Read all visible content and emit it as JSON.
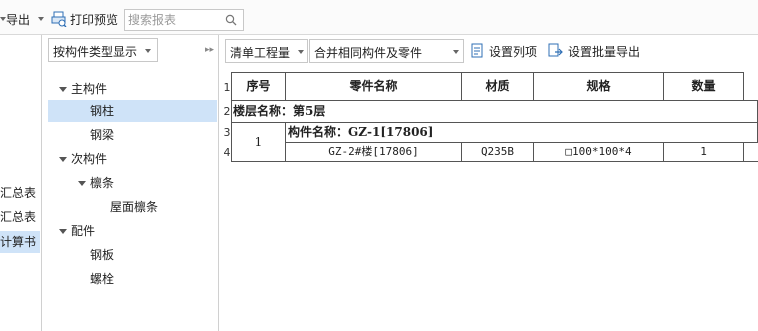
{
  "toolbar": {
    "export_label": "导出",
    "print_preview_label": "打印预览",
    "search_placeholder": "搜索报表"
  },
  "left_panel": {
    "items": [
      {
        "label": "汇总表",
        "selected": false
      },
      {
        "label": "汇总表",
        "selected": false
      },
      {
        "label": "计算书",
        "selected": true
      }
    ]
  },
  "tree_panel": {
    "display_mode": "按构件类型显示",
    "nodes": [
      {
        "label": "主构件",
        "expanded": true
      },
      {
        "label": "钢柱",
        "selected": true
      },
      {
        "label": "钢梁"
      },
      {
        "label": "次构件",
        "expanded": true
      },
      {
        "label": "檩条",
        "expanded": true
      },
      {
        "label": "屋面檩条"
      },
      {
        "label": "配件",
        "expanded": true
      },
      {
        "label": "钢板"
      },
      {
        "label": "螺栓"
      }
    ]
  },
  "main_toolbar": {
    "list_mode": "清单工程量",
    "merge_mode": "合并相同构件及零件",
    "set_columns_label": "设置列项",
    "batch_export_label": "设置批量导出"
  },
  "grid": {
    "row_numbers": [
      "1",
      "2",
      "3",
      "4"
    ],
    "headers": [
      "序号",
      "零件名称",
      "材质",
      "规格",
      "数量"
    ],
    "floor_row": "楼层名称：第5层",
    "member_row": "构件名称：GZ-1[17806]",
    "item": {
      "index": "1",
      "part_name": "GZ-2#楼[17806]",
      "material": "Q235B",
      "spec": "□100*100*4",
      "quantity": "1"
    }
  }
}
